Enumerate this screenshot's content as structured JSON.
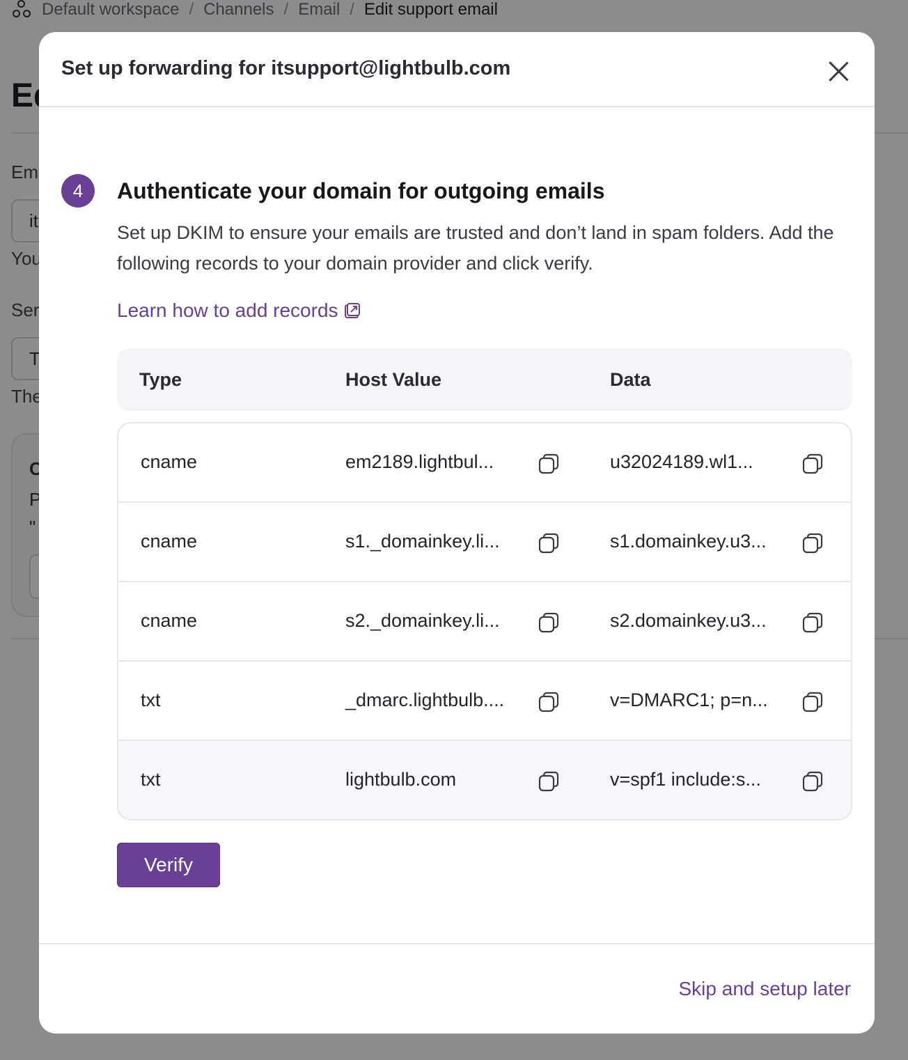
{
  "breadcrumb": {
    "items": [
      "Default workspace",
      "Channels",
      "Email"
    ],
    "current": "Edit support email",
    "separator": "/"
  },
  "background": {
    "title": "Ed",
    "labels": [
      "Em",
      "You",
      "Ser",
      "The"
    ],
    "inputs": [
      "it",
      "T"
    ],
    "card_lines": [
      "C",
      "P",
      "\""
    ]
  },
  "modal": {
    "title": "Set up forwarding for itsupport@lightbulb.com",
    "step_number": "4",
    "step_title": "Authenticate your domain for outgoing emails",
    "step_description": "Set up DKIM to ensure your emails are trusted and don’t land in spam folders. Add the following records to your domain provider and click verify.",
    "learn_link": "Learn how to add records",
    "table": {
      "headers": {
        "type": "Type",
        "host": "Host Value",
        "data": "Data"
      },
      "rows": [
        {
          "type": "cname",
          "host": "em2189.lightbul...",
          "data": "u32024189.wl1..."
        },
        {
          "type": "cname",
          "host": "s1._domainkey.li...",
          "data": "s1.domainkey.u3..."
        },
        {
          "type": "cname",
          "host": "s2._domainkey.li...",
          "data": "s2.domainkey.u3..."
        },
        {
          "type": "txt",
          "host": "_dmarc.lightbulb....",
          "data": "v=DMARC1; p=n..."
        },
        {
          "type": "txt",
          "host": "lightbulb.com",
          "data": "v=spf1 include:s..."
        }
      ]
    },
    "verify_label": "Verify",
    "skip_label": "Skip and setup later"
  },
  "colors": {
    "accent": "#6a3f96",
    "overlay": "rgba(0,0,0,0.45)"
  },
  "icons": {
    "close": "close-icon",
    "copy": "copy-icon",
    "external": "external-link-icon",
    "logo": "workspace-logo-icon"
  }
}
